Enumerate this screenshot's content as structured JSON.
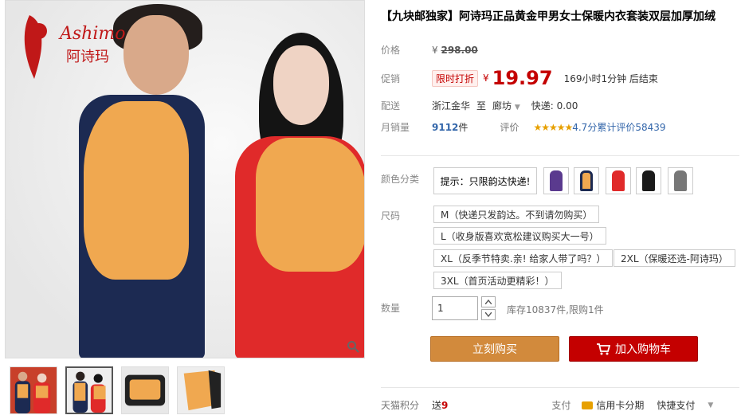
{
  "logo": {
    "text_latin": "Ashimo",
    "text_cn": "阿诗玛"
  },
  "gallery": {
    "thumb_count": 4,
    "active_index": 1
  },
  "product": {
    "title": "【九块邮独家】阿诗玛正品黄金甲男女士保暖内衣套装双层加厚加绒"
  },
  "price": {
    "label": "价格",
    "currency": "¥",
    "original": "298.00"
  },
  "promo": {
    "label": "促销",
    "tag": "限时打折",
    "currency": "¥",
    "value": "19.97",
    "ends": "169小时1分钟 后结束"
  },
  "shipping": {
    "label": "配送",
    "from": "浙江金华",
    "to_word": "至",
    "dest": "廊坊",
    "express": "快递: 0.00"
  },
  "sales": {
    "label": "月销量",
    "count": "9112",
    "unit": "件",
    "review_label": "评价",
    "stars": "★★★★★",
    "score_text": "4.7分累计评价58439"
  },
  "colors": {
    "label": "颜色分类",
    "tip": "提示：只限韵达快递!",
    "swatches": [
      "purple",
      "orange-vest",
      "red",
      "black",
      "grey"
    ]
  },
  "sizes": {
    "label": "尺码",
    "options": [
      "M（快递只发韵达。不到请勿购买）",
      "L（收身版喜欢宽松建议购买大一号）",
      "XL（反季节特卖.亲! 给家人带了吗？）",
      "2XL（保暖还选-阿诗玛）",
      "3XL（首页活动更精彩！）"
    ]
  },
  "quantity": {
    "label": "数量",
    "value": "1",
    "stock": "库存10837件,限购1件"
  },
  "buttons": {
    "buy": "立刻购买",
    "cart": "加入购物车"
  },
  "bottom": {
    "points_label": "天猫积分",
    "points_prefix": "送",
    "points_value": "9",
    "pay_label": "支付",
    "credit": "信用卡分期",
    "quick": "快捷支付"
  },
  "colors_theme": {
    "price_red": "#c40000",
    "buy_orange": "#d28a3c",
    "cart_red": "#c40000",
    "link_blue": "#3366aa"
  }
}
